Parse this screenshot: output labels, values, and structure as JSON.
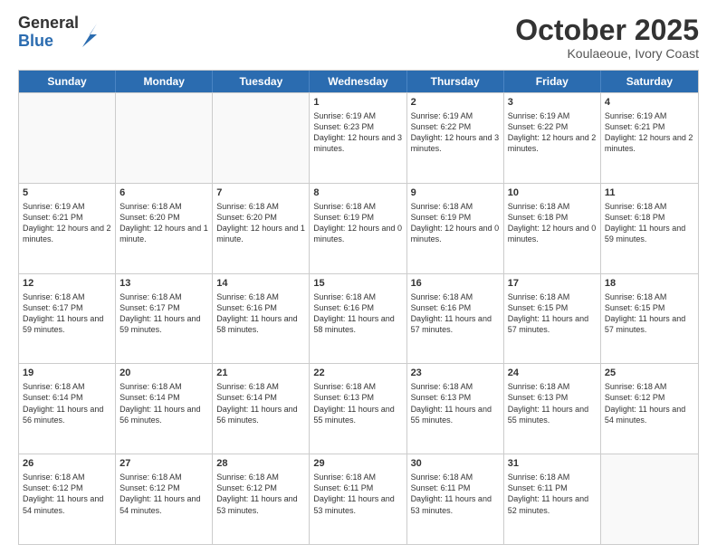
{
  "logo": {
    "general": "General",
    "blue": "Blue"
  },
  "header": {
    "month": "October 2025",
    "location": "Koulaeoue, Ivory Coast"
  },
  "weekdays": [
    "Sunday",
    "Monday",
    "Tuesday",
    "Wednesday",
    "Thursday",
    "Friday",
    "Saturday"
  ],
  "weeks": [
    [
      {
        "day": "",
        "sunrise": "",
        "sunset": "",
        "daylight": ""
      },
      {
        "day": "",
        "sunrise": "",
        "sunset": "",
        "daylight": ""
      },
      {
        "day": "",
        "sunrise": "",
        "sunset": "",
        "daylight": ""
      },
      {
        "day": "1",
        "sunrise": "Sunrise: 6:19 AM",
        "sunset": "Sunset: 6:23 PM",
        "daylight": "Daylight: 12 hours and 3 minutes."
      },
      {
        "day": "2",
        "sunrise": "Sunrise: 6:19 AM",
        "sunset": "Sunset: 6:22 PM",
        "daylight": "Daylight: 12 hours and 3 minutes."
      },
      {
        "day": "3",
        "sunrise": "Sunrise: 6:19 AM",
        "sunset": "Sunset: 6:22 PM",
        "daylight": "Daylight: 12 hours and 2 minutes."
      },
      {
        "day": "4",
        "sunrise": "Sunrise: 6:19 AM",
        "sunset": "Sunset: 6:21 PM",
        "daylight": "Daylight: 12 hours and 2 minutes."
      }
    ],
    [
      {
        "day": "5",
        "sunrise": "Sunrise: 6:19 AM",
        "sunset": "Sunset: 6:21 PM",
        "daylight": "Daylight: 12 hours and 2 minutes."
      },
      {
        "day": "6",
        "sunrise": "Sunrise: 6:18 AM",
        "sunset": "Sunset: 6:20 PM",
        "daylight": "Daylight: 12 hours and 1 minute."
      },
      {
        "day": "7",
        "sunrise": "Sunrise: 6:18 AM",
        "sunset": "Sunset: 6:20 PM",
        "daylight": "Daylight: 12 hours and 1 minute."
      },
      {
        "day": "8",
        "sunrise": "Sunrise: 6:18 AM",
        "sunset": "Sunset: 6:19 PM",
        "daylight": "Daylight: 12 hours and 0 minutes."
      },
      {
        "day": "9",
        "sunrise": "Sunrise: 6:18 AM",
        "sunset": "Sunset: 6:19 PM",
        "daylight": "Daylight: 12 hours and 0 minutes."
      },
      {
        "day": "10",
        "sunrise": "Sunrise: 6:18 AM",
        "sunset": "Sunset: 6:18 PM",
        "daylight": "Daylight: 12 hours and 0 minutes."
      },
      {
        "day": "11",
        "sunrise": "Sunrise: 6:18 AM",
        "sunset": "Sunset: 6:18 PM",
        "daylight": "Daylight: 11 hours and 59 minutes."
      }
    ],
    [
      {
        "day": "12",
        "sunrise": "Sunrise: 6:18 AM",
        "sunset": "Sunset: 6:17 PM",
        "daylight": "Daylight: 11 hours and 59 minutes."
      },
      {
        "day": "13",
        "sunrise": "Sunrise: 6:18 AM",
        "sunset": "Sunset: 6:17 PM",
        "daylight": "Daylight: 11 hours and 59 minutes."
      },
      {
        "day": "14",
        "sunrise": "Sunrise: 6:18 AM",
        "sunset": "Sunset: 6:16 PM",
        "daylight": "Daylight: 11 hours and 58 minutes."
      },
      {
        "day": "15",
        "sunrise": "Sunrise: 6:18 AM",
        "sunset": "Sunset: 6:16 PM",
        "daylight": "Daylight: 11 hours and 58 minutes."
      },
      {
        "day": "16",
        "sunrise": "Sunrise: 6:18 AM",
        "sunset": "Sunset: 6:16 PM",
        "daylight": "Daylight: 11 hours and 57 minutes."
      },
      {
        "day": "17",
        "sunrise": "Sunrise: 6:18 AM",
        "sunset": "Sunset: 6:15 PM",
        "daylight": "Daylight: 11 hours and 57 minutes."
      },
      {
        "day": "18",
        "sunrise": "Sunrise: 6:18 AM",
        "sunset": "Sunset: 6:15 PM",
        "daylight": "Daylight: 11 hours and 57 minutes."
      }
    ],
    [
      {
        "day": "19",
        "sunrise": "Sunrise: 6:18 AM",
        "sunset": "Sunset: 6:14 PM",
        "daylight": "Daylight: 11 hours and 56 minutes."
      },
      {
        "day": "20",
        "sunrise": "Sunrise: 6:18 AM",
        "sunset": "Sunset: 6:14 PM",
        "daylight": "Daylight: 11 hours and 56 minutes."
      },
      {
        "day": "21",
        "sunrise": "Sunrise: 6:18 AM",
        "sunset": "Sunset: 6:14 PM",
        "daylight": "Daylight: 11 hours and 56 minutes."
      },
      {
        "day": "22",
        "sunrise": "Sunrise: 6:18 AM",
        "sunset": "Sunset: 6:13 PM",
        "daylight": "Daylight: 11 hours and 55 minutes."
      },
      {
        "day": "23",
        "sunrise": "Sunrise: 6:18 AM",
        "sunset": "Sunset: 6:13 PM",
        "daylight": "Daylight: 11 hours and 55 minutes."
      },
      {
        "day": "24",
        "sunrise": "Sunrise: 6:18 AM",
        "sunset": "Sunset: 6:13 PM",
        "daylight": "Daylight: 11 hours and 55 minutes."
      },
      {
        "day": "25",
        "sunrise": "Sunrise: 6:18 AM",
        "sunset": "Sunset: 6:12 PM",
        "daylight": "Daylight: 11 hours and 54 minutes."
      }
    ],
    [
      {
        "day": "26",
        "sunrise": "Sunrise: 6:18 AM",
        "sunset": "Sunset: 6:12 PM",
        "daylight": "Daylight: 11 hours and 54 minutes."
      },
      {
        "day": "27",
        "sunrise": "Sunrise: 6:18 AM",
        "sunset": "Sunset: 6:12 PM",
        "daylight": "Daylight: 11 hours and 54 minutes."
      },
      {
        "day": "28",
        "sunrise": "Sunrise: 6:18 AM",
        "sunset": "Sunset: 6:12 PM",
        "daylight": "Daylight: 11 hours and 53 minutes."
      },
      {
        "day": "29",
        "sunrise": "Sunrise: 6:18 AM",
        "sunset": "Sunset: 6:11 PM",
        "daylight": "Daylight: 11 hours and 53 minutes."
      },
      {
        "day": "30",
        "sunrise": "Sunrise: 6:18 AM",
        "sunset": "Sunset: 6:11 PM",
        "daylight": "Daylight: 11 hours and 53 minutes."
      },
      {
        "day": "31",
        "sunrise": "Sunrise: 6:18 AM",
        "sunset": "Sunset: 6:11 PM",
        "daylight": "Daylight: 11 hours and 52 minutes."
      },
      {
        "day": "",
        "sunrise": "",
        "sunset": "",
        "daylight": ""
      }
    ]
  ]
}
